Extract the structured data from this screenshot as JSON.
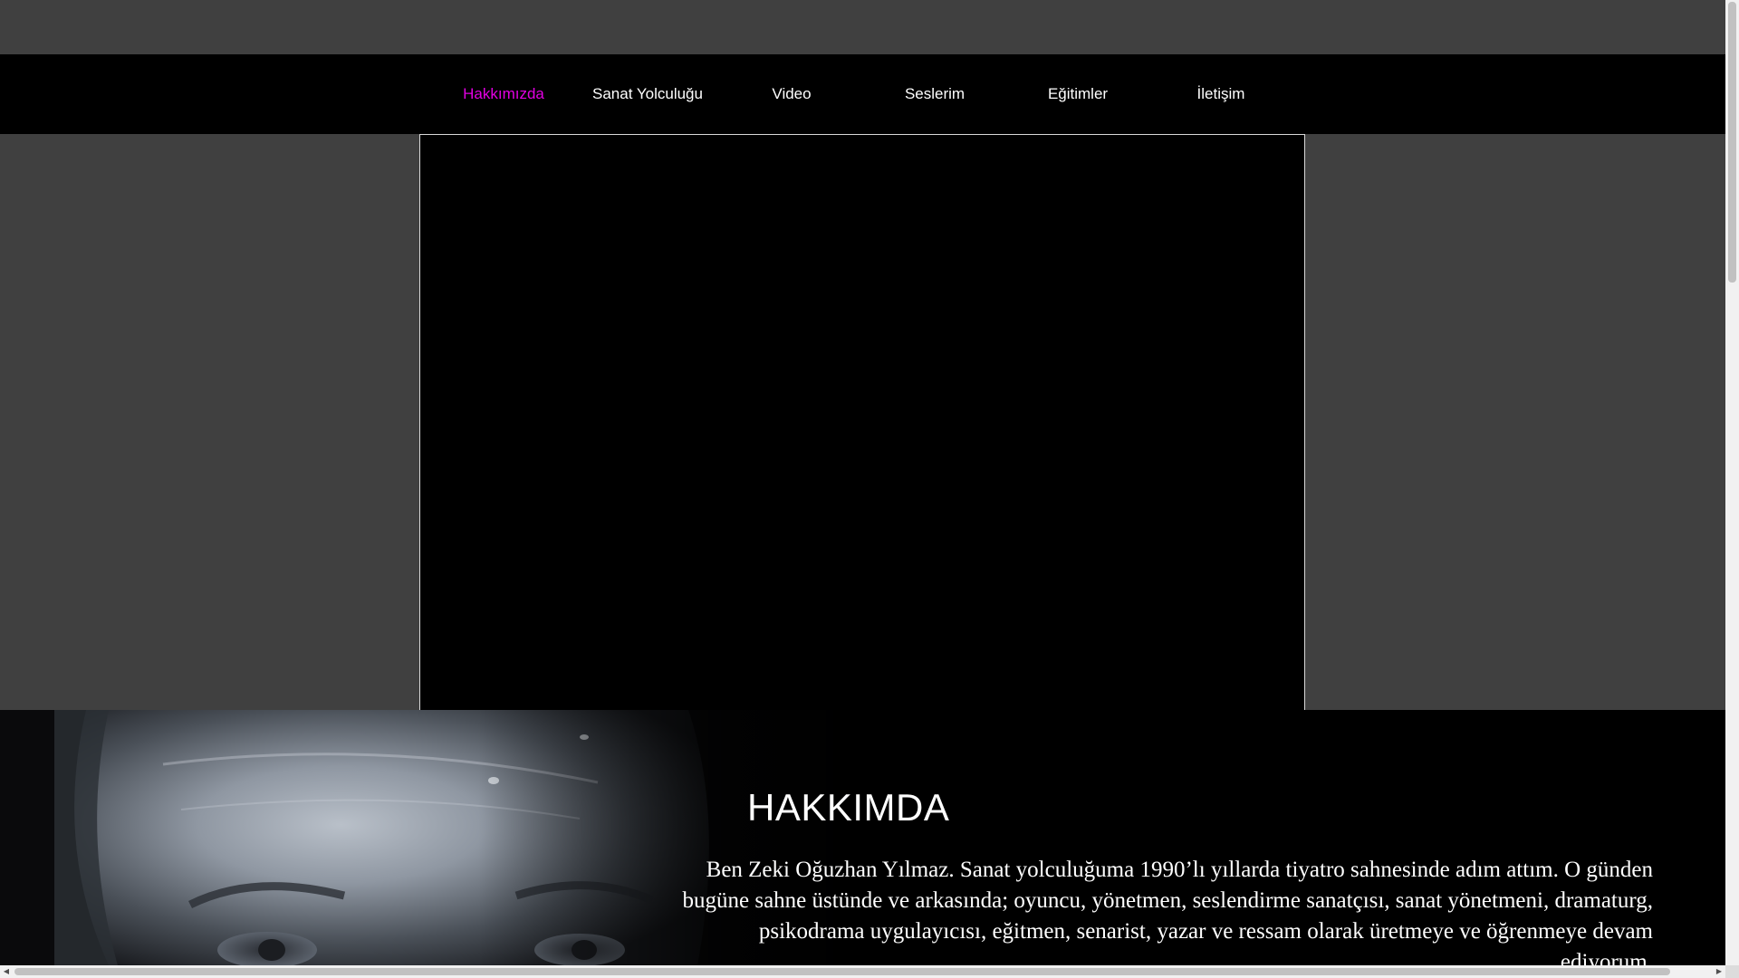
{
  "nav": {
    "items": [
      {
        "label": "Hakkımızda",
        "active": true
      },
      {
        "label": "Sanat Yolculuğu",
        "active": false
      },
      {
        "label": "Video",
        "active": false
      },
      {
        "label": "Seslerim",
        "active": false
      },
      {
        "label": "Eğitimler",
        "active": false
      },
      {
        "label": "İletişim",
        "active": false
      }
    ],
    "active_color": "#e200e2"
  },
  "about": {
    "title": "HAKKIMDA",
    "text": "Ben Zeki Oğuzhan Yılmaz. Sanat yolculuğuma 1990’lı yıllarda tiyatro sahnesinde adım attım. O günden bugüne sahne üstünde ve arkasında; oyuncu, yönetmen, seslendirme sanatçısı, sanat yönetmeni, dramaturg, psikodrama uygulayıcısı, eğitmen, senarist, yazar ve ressam olarak üretmeye ve öğrenmeye devam ediyorum."
  },
  "scrollbar_arrows": {
    "left": "◀",
    "right": "▶"
  },
  "colors": {
    "background": "#404040",
    "navbar": "#000000",
    "text": "#ffffff"
  }
}
